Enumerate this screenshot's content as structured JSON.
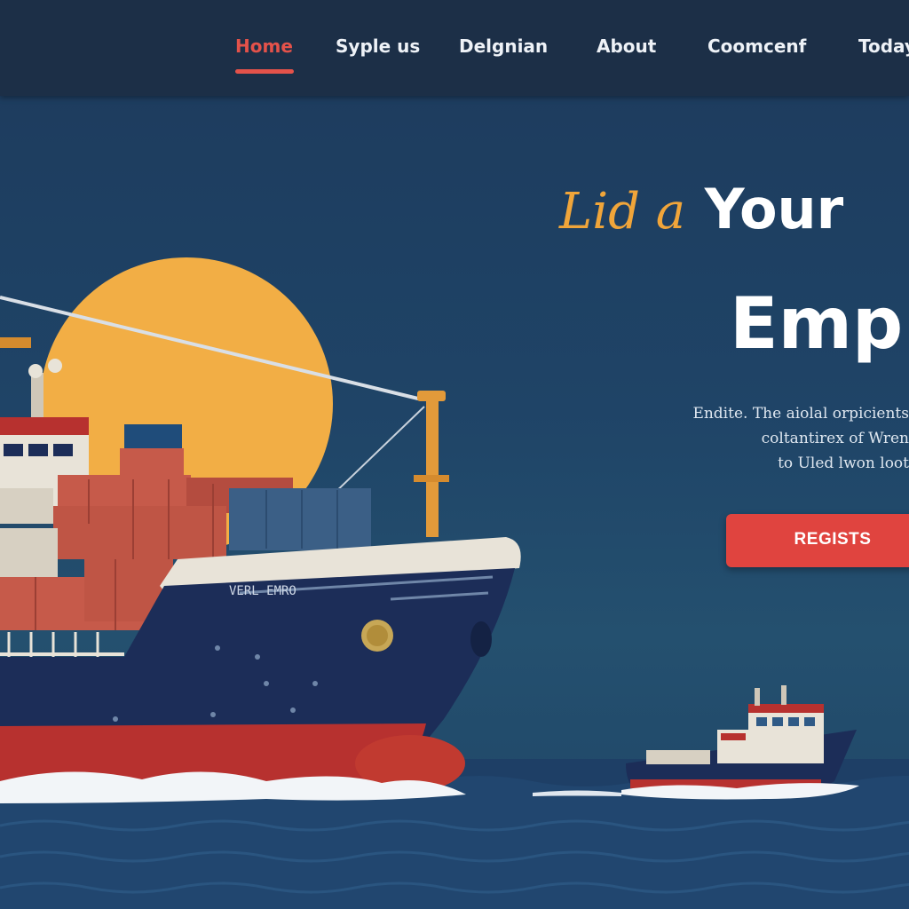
{
  "nav": {
    "items": [
      {
        "label": "Home",
        "active": true
      },
      {
        "label": "Syple us",
        "active": false
      },
      {
        "label": "Delgnian",
        "active": false
      },
      {
        "label": "About",
        "active": false
      },
      {
        "label": "Coomcenf",
        "active": false
      },
      {
        "label": "Today",
        "active": false
      }
    ]
  },
  "hero": {
    "title_accent": "Lid a",
    "title_strong": "Your",
    "title_line2": "Emp",
    "description_lines": [
      "Endite. The aiolal orpicients",
      "coltantirex of Wren",
      "to Uled lwon loot"
    ],
    "cta_label": "REGISTS"
  },
  "illustration": {
    "ship_name": "VERL EMRO",
    "icons": [
      "sun-icon",
      "cargo-ship-icon",
      "tugboat-icon",
      "ocean-waves-icon"
    ]
  },
  "colors": {
    "navbar_bg": "#1c2f47",
    "accent_red": "#e4524a",
    "accent_orange": "#f0a53a",
    "hero_bg": "#1f4467",
    "sun": "#f2ae45",
    "hull_navy": "#1c2d58",
    "hull_red": "#b7312f"
  }
}
